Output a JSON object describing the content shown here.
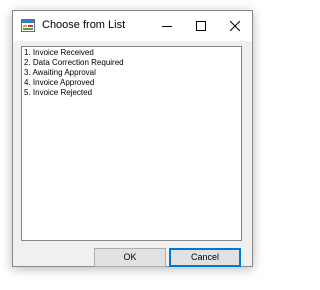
{
  "window": {
    "title": "Choose from List",
    "icon": "form-app-icon"
  },
  "caption_buttons": {
    "minimize_icon": "minimize-icon",
    "maximize_icon": "maximize-icon",
    "close_icon": "close-icon"
  },
  "list": {
    "items": [
      "1. Invoice Received",
      "2. Data Correction Required",
      "3. Awaiting Approval",
      "4. Invoice Approved",
      "5. Invoice Rejected"
    ]
  },
  "buttons": {
    "ok_label": "OK",
    "cancel_label": "Cancel"
  },
  "colors": {
    "focus_accent": "#0078d7",
    "button_face": "#e1e1e1",
    "dialog_background": "#f0f0f0"
  }
}
